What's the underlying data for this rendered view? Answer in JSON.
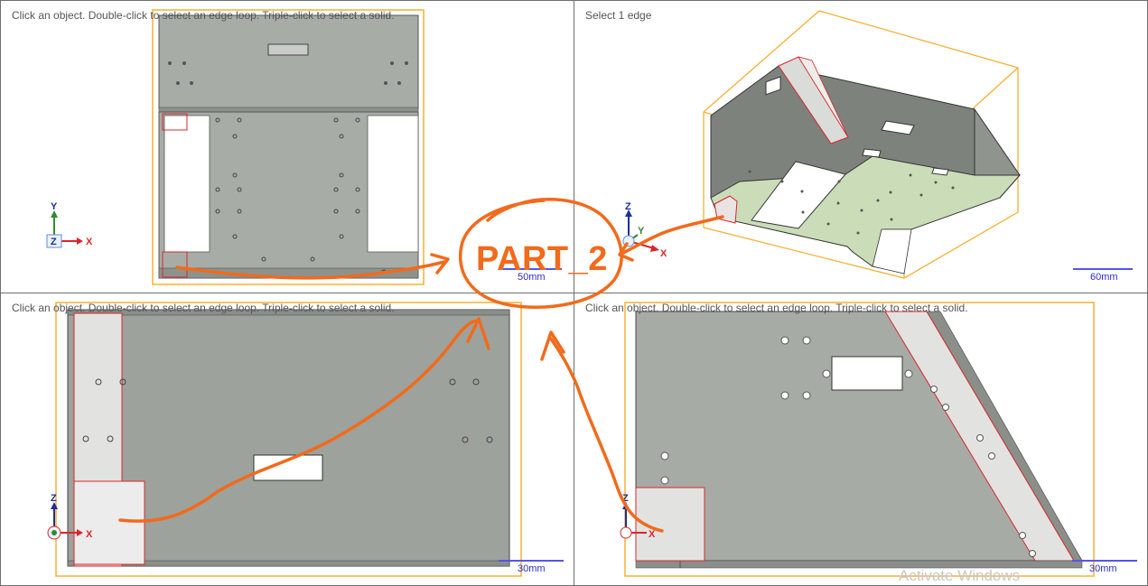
{
  "viewports": {
    "top_left": {
      "hint": "Click an object. Double-click to select an edge loop. Triple-click to select a solid.",
      "scale": "50mm"
    },
    "top_right": {
      "hint": "Select 1 edge",
      "scale": "60mm"
    },
    "bottom_left": {
      "hint": "Click an object. Double-click to select an edge loop. Triple-click to select a solid.",
      "scale": "30mm"
    },
    "bottom_right": {
      "hint": "Click an object. Double-click to select an edge loop. Triple-click to select a solid.",
      "scale": "30mm"
    }
  },
  "axes": {
    "x": "X",
    "y": "Y",
    "z": "Z"
  },
  "annotation": {
    "label": "PART_2",
    "color": "#f26a1b"
  },
  "colors": {
    "part_gray": "#a4aaa3",
    "part_dark": "#8d928c",
    "selection_orange": "#f5b133",
    "highlight_red": "#d9262b",
    "green_face": "#cbdcb9"
  },
  "watermark": "Activate Windows"
}
